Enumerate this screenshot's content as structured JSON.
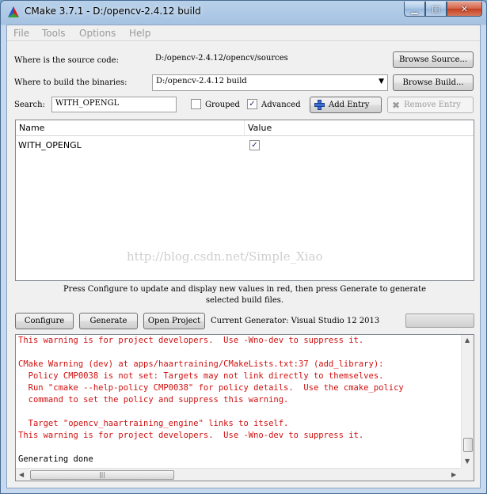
{
  "window": {
    "title": "CMake 3.7.1 - D:/opencv-2.4.12 build"
  },
  "menu": [
    "File",
    "Tools",
    "Options",
    "Help"
  ],
  "source": {
    "label": "Where is the source code:",
    "value": "D:/opencv-2.4.12/opencv/sources",
    "browse": "Browse Source..."
  },
  "build": {
    "label": "Where to build the binaries:",
    "value": "D:/opencv-2.4.12 build",
    "browse": "Browse Build..."
  },
  "search": {
    "label": "Search:",
    "value": "WITH_OPENGL"
  },
  "grouped": {
    "label": "Grouped",
    "checked": false
  },
  "advanced": {
    "label": "Advanced",
    "checked": true
  },
  "add_entry": "Add Entry",
  "remove_entry": "Remove Entry",
  "table": {
    "headers": {
      "name": "Name",
      "value": "Value"
    },
    "rows": [
      {
        "name": "WITH_OPENGL",
        "checked": true
      }
    ]
  },
  "watermark": "http://blog.csdn.net/Simple_Xiao",
  "info_line1": "Press Configure to update and display new values in red, then press Generate to generate",
  "info_line2": "selected build files.",
  "actions": {
    "configure": "Configure",
    "generate": "Generate",
    "open_project": "Open Project"
  },
  "generator": "Current Generator: Visual Studio 12 2013",
  "output": [
    {
      "text": "This warning is for project developers.  Use -Wno-dev to suppress it.",
      "color": "red"
    },
    {
      "text": "",
      "color": "red"
    },
    {
      "text": "CMake Warning (dev) at apps/haartraining/CMakeLists.txt:37 (add_library):",
      "color": "red"
    },
    {
      "text": "  Policy CMP0038 is not set: Targets may not link directly to themselves.",
      "color": "red"
    },
    {
      "text": "  Run \"cmake --help-policy CMP0038\" for policy details.  Use the cmake_policy",
      "color": "red"
    },
    {
      "text": "  command to set the policy and suppress this warning.",
      "color": "red"
    },
    {
      "text": "",
      "color": "red"
    },
    {
      "text": "  Target \"opencv_haartraining_engine\" links to itself.",
      "color": "red"
    },
    {
      "text": "This warning is for project developers.  Use -Wno-dev to suppress it.",
      "color": "red"
    },
    {
      "text": "",
      "color": "black"
    },
    {
      "text": "Generating done",
      "color": "black"
    }
  ]
}
